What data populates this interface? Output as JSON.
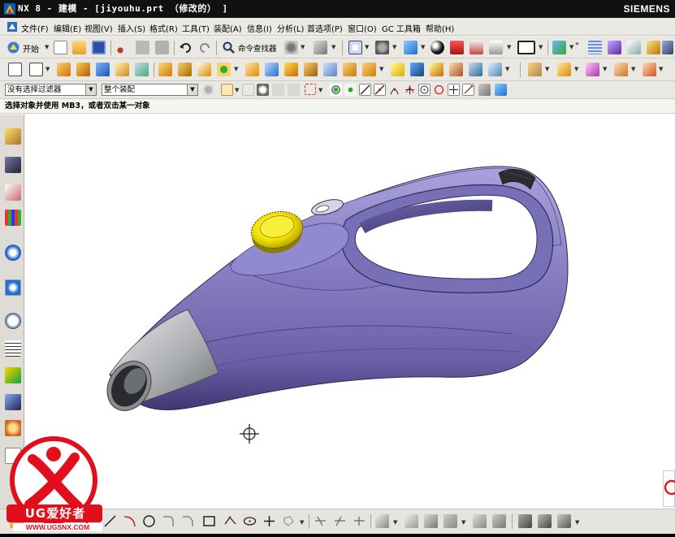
{
  "window": {
    "title": "NX 8 - 建模 - [jiyouhu.prt （修改的） ]",
    "brand": "SIEMENS"
  },
  "menu": {
    "items": [
      "文件(F)",
      "编辑(E)",
      "视图(V)",
      "插入(S)",
      "格式(R)",
      "工具(T)",
      "装配(A)",
      "信息(I)",
      "分析(L)",
      "首选项(P)",
      "窗口(O)",
      "GC 工具箱",
      "帮助(H)"
    ]
  },
  "toolbar": {
    "start_label": "开始",
    "command_finder_label": "命令查找器"
  },
  "selection_bar": {
    "filter_value": "没有选择过滤器",
    "scope_value": "整个装配"
  },
  "cue_line": {
    "text": "选择对象并使用 MB3，或者双击某一对象"
  },
  "watermark": {
    "brand": "UG爱好者",
    "url": "WWW.UGSNX.COM"
  },
  "colors": {
    "model_body": "#8d82c4",
    "model_shadow": "#463f78",
    "knob": "#f4e300",
    "nozzle": "#b9bcbf",
    "graphics_bg": "#ffffff",
    "watermark_red": "#e10f1b"
  },
  "icons": {
    "left_resource_bar": [
      "assembly-navigator-icon",
      "constraint-navigator-icon",
      "part-navigator-icon",
      "reuse-library-icon",
      "web-browser-icon",
      "history-icon",
      "process-studio-icon",
      "visualization-icon",
      "roles-icon",
      "system-materials-icon"
    ]
  }
}
